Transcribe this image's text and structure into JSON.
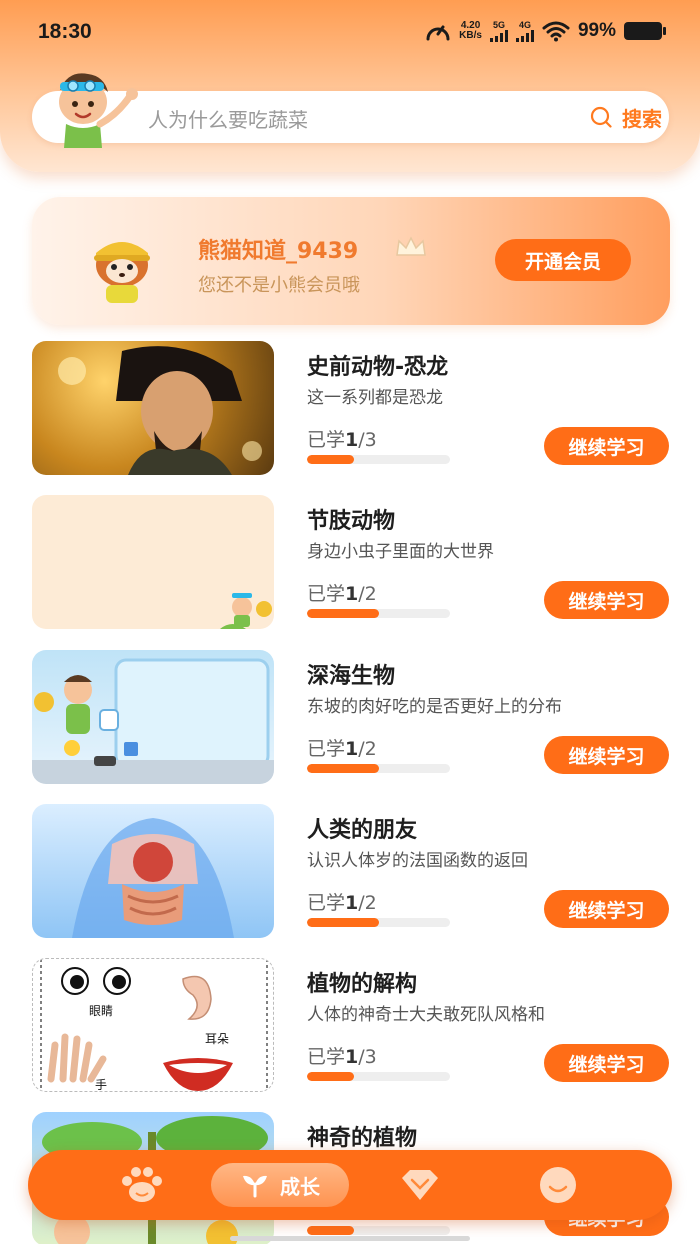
{
  "status_bar": {
    "time": "18:30",
    "speed_value": "4.20",
    "speed_unit": "KB/s",
    "sig1_label": "5G",
    "sig2_label": "4G",
    "battery": "99%"
  },
  "search": {
    "placeholder": "人为什么要吃蔬菜",
    "button_label": "搜索"
  },
  "member": {
    "username": "熊猫知道_9439",
    "subtitle": "您还不是小熊会员哦",
    "button_label": "开通会员"
  },
  "courses": [
    {
      "title": "史前动物-恐龙",
      "desc": "这一系列都是恐龙",
      "progress_label": "已学",
      "done": "1",
      "total": "/3",
      "fraction": 0.33,
      "button": "继续学习"
    },
    {
      "title": "节肢动物",
      "desc": "身边小虫子里面的大世界",
      "progress_label": "已学",
      "done": "1",
      "total": "/2",
      "fraction": 0.5,
      "button": "继续学习"
    },
    {
      "title": "深海生物",
      "desc": "东坡的肉好吃的是否更好上的分布",
      "progress_label": "已学",
      "done": "1",
      "total": "/2",
      "fraction": 0.5,
      "button": "继续学习"
    },
    {
      "title": "人类的朋友",
      "desc": "认识人体岁的法国函数的返回",
      "progress_label": "已学",
      "done": "1",
      "total": "/2",
      "fraction": 0.5,
      "button": "继续学习"
    },
    {
      "title": "植物的解构",
      "desc": "人体的神奇士大夫敢死队风格和",
      "progress_label": "已学",
      "done": "1",
      "total": "/3",
      "fraction": 0.33,
      "button": "继续学习"
    },
    {
      "title": "神奇的植物",
      "desc": "",
      "progress_label": "",
      "done": "",
      "total": "",
      "fraction": 0.33,
      "button": "继续学习"
    }
  ],
  "face_labels": {
    "eyes": "眼睛",
    "ear": "耳朵",
    "hand": "手"
  },
  "nav": {
    "active_label": "成长"
  },
  "colors": {
    "accent": "#ff6d17",
    "header_top": "#ff9d52",
    "member_name": "#f07a2e"
  }
}
